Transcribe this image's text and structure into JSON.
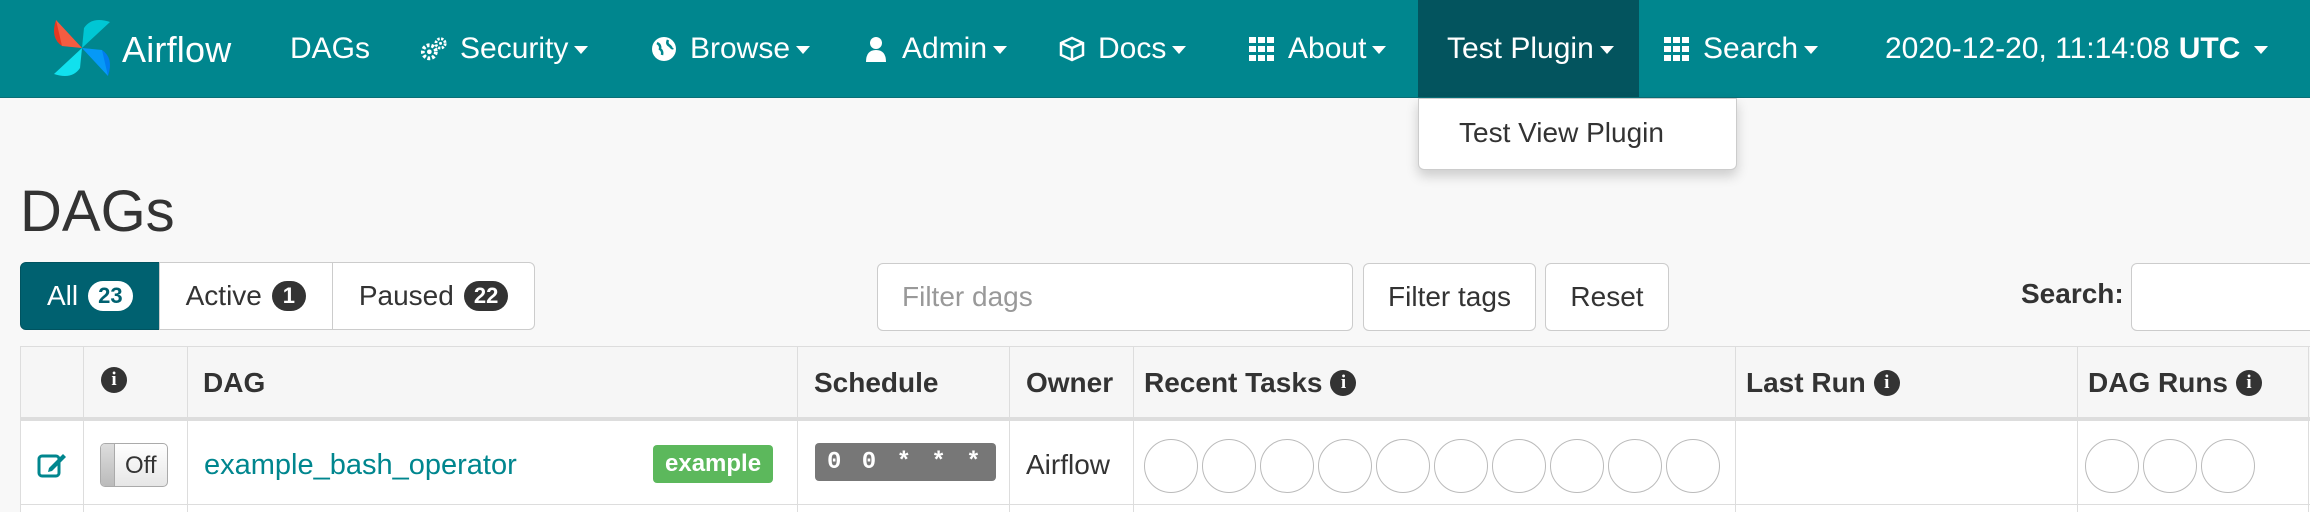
{
  "navbar": {
    "brand": "Airflow",
    "items": [
      {
        "label": "DAGs",
        "icon": ""
      },
      {
        "label": "Security",
        "icon": "gears-icon"
      },
      {
        "label": "Browse",
        "icon": "globe-icon"
      },
      {
        "label": "Admin",
        "icon": "user-icon"
      },
      {
        "label": "Docs",
        "icon": "cube-icon"
      },
      {
        "label": "About",
        "icon": "grid-icon"
      },
      {
        "label": "Test Plugin",
        "icon": ""
      },
      {
        "label": "Search",
        "icon": "grid-icon"
      }
    ],
    "datetime": "2020-12-20, 11:14:08",
    "timezone": "UTC",
    "bar_color": "#00868e",
    "active_color": "#03545e"
  },
  "dropdown": {
    "items": [
      "Test View Plugin"
    ]
  },
  "page": {
    "title": "DAGs",
    "filter_tabs": [
      {
        "label": "All",
        "count": "23"
      },
      {
        "label": "Active",
        "count": "1"
      },
      {
        "label": "Paused",
        "count": "22"
      }
    ],
    "filter_dags_placeholder": "Filter dags",
    "filter_tags_label": "Filter tags",
    "reset_label": "Reset",
    "search_label": "Search:"
  },
  "table": {
    "headers": {
      "dag": "DAG",
      "schedule": "Schedule",
      "owner": "Owner",
      "recent_tasks": "Recent Tasks",
      "last_run": "Last Run",
      "dag_runs": "DAG Runs"
    },
    "rows": [
      {
        "toggle": "Off",
        "dag_id": "example_bash_operator",
        "tag": "example",
        "schedule": "0 0 * * *",
        "owner": "Airflow",
        "recent_task_circles": 10,
        "dag_run_circles": 3
      }
    ]
  }
}
